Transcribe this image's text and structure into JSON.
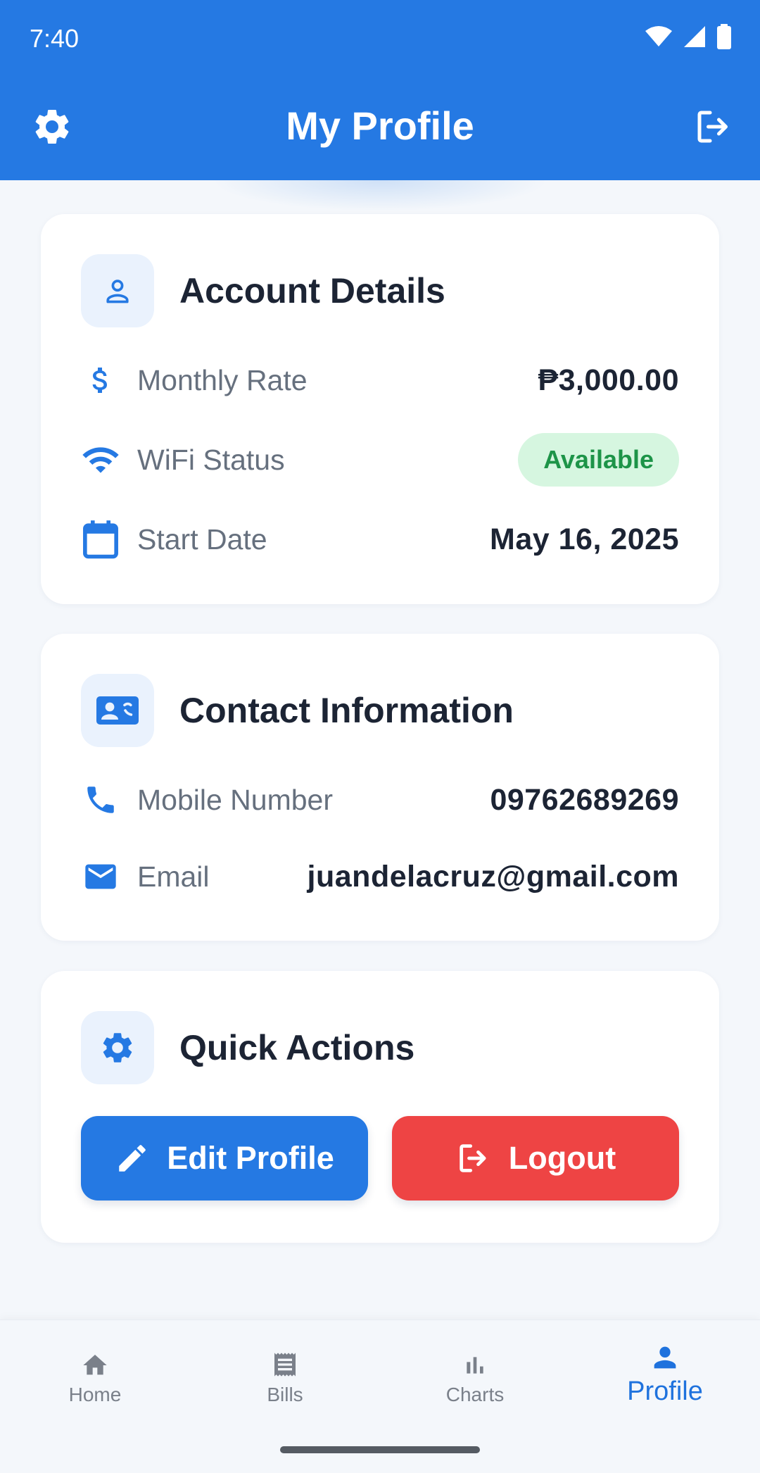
{
  "status_bar": {
    "time": "7:40"
  },
  "header": {
    "title": "My Profile"
  },
  "account": {
    "title": "Account Details",
    "rows": [
      {
        "label": "Monthly Rate",
        "value": "₱3,000.00"
      },
      {
        "label": "WiFi Status",
        "value": "Available"
      },
      {
        "label": "Start Date",
        "value": "May 16, 2025"
      }
    ]
  },
  "contact": {
    "title": "Contact Information",
    "rows": [
      {
        "label": "Mobile Number",
        "value": "09762689269"
      },
      {
        "label": "Email",
        "value": "juandelacruz@gmail.com"
      }
    ]
  },
  "actions": {
    "title": "Quick Actions",
    "edit_label": "Edit Profile",
    "logout_label": "Logout"
  },
  "nav": {
    "items": [
      {
        "label": "Home",
        "icon": "home-icon"
      },
      {
        "label": "Bills",
        "icon": "receipt-icon"
      },
      {
        "label": "Charts",
        "icon": "bar-chart-icon"
      },
      {
        "label": "Profile",
        "icon": "person-icon",
        "active": true
      }
    ]
  },
  "colors": {
    "primary": "#2579e3",
    "danger": "#ee4444",
    "success_bg": "#d6f6e0",
    "success_text": "#1d9448",
    "background": "#f4f7fb"
  }
}
